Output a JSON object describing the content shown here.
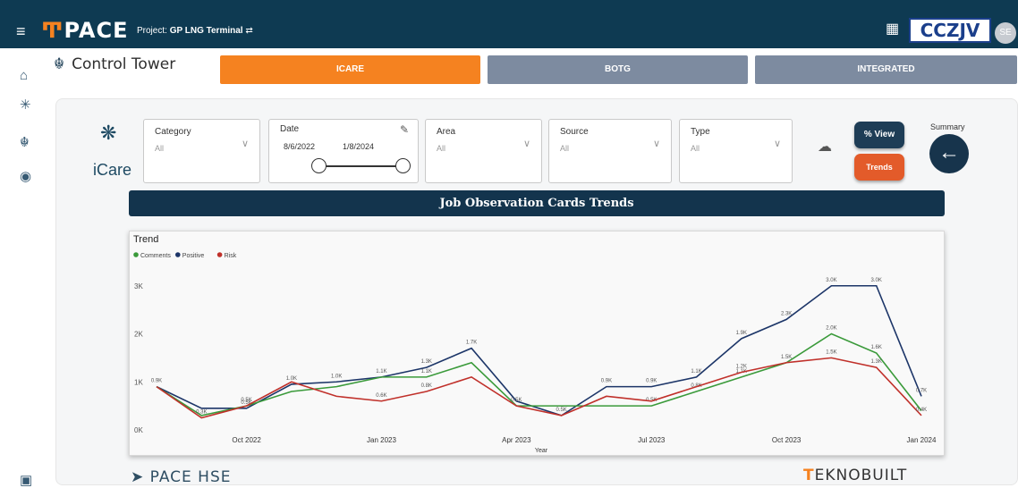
{
  "header": {
    "menu_icon": "menu-icon",
    "logo_mark": "Ͳ",
    "logo_text": "PACE",
    "project_label": "Project:",
    "project_name": "GP LNG Terminal",
    "brand": "CCZJV",
    "avatar_initials": "SE"
  },
  "sidebar": {
    "icons": [
      "home-icon",
      "asterisk-icon",
      "control-tower-icon",
      "headset-icon",
      "settings-bottom-icon"
    ]
  },
  "page": {
    "title": "Control Tower",
    "tabs": [
      {
        "label": "ICARE",
        "active": true
      },
      {
        "label": "BOTG",
        "active": false
      },
      {
        "label": "INTEGRATED",
        "active": false
      }
    ]
  },
  "filters": {
    "brand_text": "iCare",
    "category": {
      "label": "Category",
      "value": "All"
    },
    "date": {
      "label": "Date",
      "from": "8/6/2022",
      "to": "1/8/2024"
    },
    "area": {
      "label": "Area",
      "value": "All"
    },
    "source": {
      "label": "Source",
      "value": "All"
    },
    "type": {
      "label": "Type",
      "value": "All"
    },
    "view_button": "% View",
    "trends_button": "Trends",
    "summary_label": "Summary"
  },
  "report_title": "Job Observation Cards Trends",
  "footer": {
    "pace_hse": "PACE HSE",
    "teknobuilt": "EKNOBUILT"
  },
  "colors": {
    "header_bg": "#0e3a52",
    "accent_orange": "#f58220",
    "tab_inactive": "#7d8ba0",
    "comments": "#3a9a3a",
    "positive": "#1c3568",
    "risk": "#c0302a"
  },
  "chart_data": {
    "type": "line",
    "title": "Trend",
    "xlabel": "Year",
    "ylabel": "",
    "ylim": [
      0,
      3200
    ],
    "yticks": [
      "0K",
      "1K",
      "2K",
      "3K"
    ],
    "xticks": [
      "Oct 2022",
      "Jan 2023",
      "Apr 2023",
      "Jul 2023",
      "Oct 2023",
      "Jan 2024"
    ],
    "legend": [
      "Comments",
      "Positive",
      "Risk"
    ],
    "legend_position": "top-left",
    "series": [
      {
        "name": "Positive",
        "color": "#1c3568",
        "values": [
          900,
          450,
          450,
          950,
          1000,
          1100,
          1300,
          1700,
          600,
          300,
          900,
          900,
          1100,
          1900,
          2300,
          3000,
          3000,
          700
        ],
        "labels": [
          "0.9K",
          "",
          "0.5K",
          "1.0K",
          "1.0K",
          "1.1K",
          "1.3K",
          "1.7K",
          "",
          "",
          "0.9K",
          "0.9K",
          "1.1K",
          "1.9K",
          "2.3K",
          "3.0K",
          "3.0K",
          "0.7K"
        ]
      },
      {
        "name": "Comments",
        "color": "#3a9a3a",
        "values": [
          900,
          300,
          500,
          800,
          900,
          1100,
          1100,
          1400,
          500,
          500,
          500,
          500,
          800,
          1100,
          1400,
          2000,
          1600,
          400
        ],
        "labels": [
          "",
          "",
          "0.5K",
          "",
          "",
          "",
          "1.1K",
          "",
          "0.5K",
          "",
          "",
          "0.5K",
          "0.8K",
          "1.1K",
          "1.5K",
          "2.0K",
          "1.6K",
          ""
        ]
      },
      {
        "name": "Risk",
        "color": "#c0302a",
        "values": [
          900,
          250,
          500,
          1000,
          700,
          600,
          800,
          1100,
          500,
          300,
          700,
          600,
          900,
          1200,
          1400,
          1500,
          1300,
          300
        ],
        "labels": [
          "",
          "0.3K",
          "",
          "",
          "",
          "0.6K",
          "0.8K",
          "",
          "",
          "0.5K",
          "",
          "",
          "",
          "1.2K",
          "",
          "1.5K",
          "1.3K",
          "0.4K"
        ]
      }
    ]
  }
}
